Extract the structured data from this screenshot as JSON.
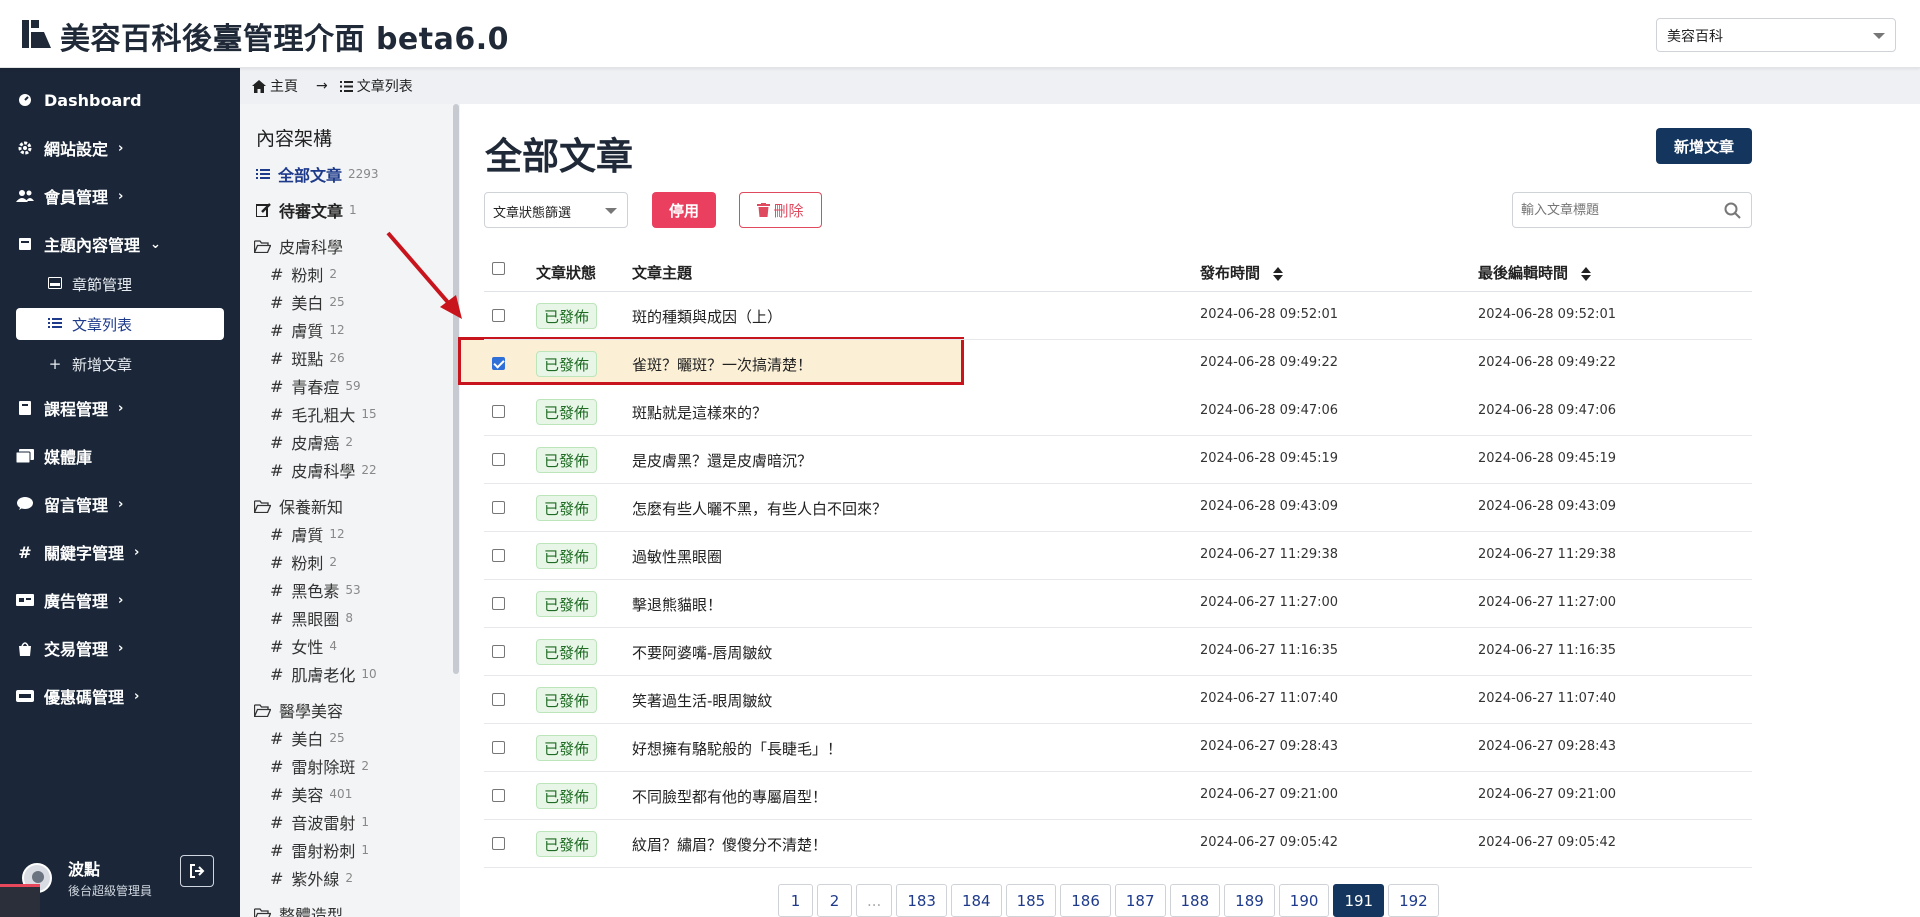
{
  "app_title": "美容百科後臺管理介面 beta6.0",
  "site_selector": {
    "value": "美容百科"
  },
  "sidebar": {
    "items": [
      {
        "label": "Dashboard"
      },
      {
        "label": "網站設定"
      },
      {
        "label": "會員管理"
      },
      {
        "label": "主題內容管理"
      },
      {
        "label": "課程管理"
      },
      {
        "label": "媒體庫"
      },
      {
        "label": "留言管理"
      },
      {
        "label": "關鍵字管理"
      },
      {
        "label": "廣告管理"
      },
      {
        "label": "交易管理"
      },
      {
        "label": "優惠碼管理"
      }
    ],
    "sub_items": [
      {
        "label": "章節管理"
      },
      {
        "label": "文章列表"
      },
      {
        "label": "新增文章"
      }
    ],
    "user": {
      "name": "波點",
      "role": "後台超級管理員"
    }
  },
  "breadcrumb": {
    "home": "主頁",
    "current": "文章列表"
  },
  "category_panel": {
    "heading": "內容架構",
    "all": {
      "label": "全部文章",
      "count": "2293"
    },
    "pending": {
      "label": "待審文章",
      "count": "1"
    },
    "groups": [
      {
        "name": "皮膚科學",
        "items": [
          {
            "label": "粉刺",
            "count": "2"
          },
          {
            "label": "美白",
            "count": "25"
          },
          {
            "label": "膚質",
            "count": "12"
          },
          {
            "label": "斑點",
            "count": "26"
          },
          {
            "label": "青春痘",
            "count": "59"
          },
          {
            "label": "毛孔粗大",
            "count": "15"
          },
          {
            "label": "皮膚癌",
            "count": "2"
          },
          {
            "label": "皮膚科學",
            "count": "22"
          }
        ]
      },
      {
        "name": "保養新知",
        "items": [
          {
            "label": "膚質",
            "count": "12"
          },
          {
            "label": "粉刺",
            "count": "2"
          },
          {
            "label": "黑色素",
            "count": "53"
          },
          {
            "label": "黑眼圈",
            "count": "8"
          },
          {
            "label": "女性",
            "count": "4"
          },
          {
            "label": "肌膚老化",
            "count": "10"
          }
        ]
      },
      {
        "name": "醫學美容",
        "items": [
          {
            "label": "美白",
            "count": "25"
          },
          {
            "label": "雷射除斑",
            "count": "2"
          },
          {
            "label": "美容",
            "count": "401"
          },
          {
            "label": "音波雷射",
            "count": "1"
          },
          {
            "label": "雷射粉刺",
            "count": "1"
          },
          {
            "label": "紫外線",
            "count": "2"
          }
        ]
      },
      {
        "name": "整體造型",
        "items": []
      }
    ]
  },
  "main": {
    "title": "全部文章",
    "new_button": "新增文章",
    "status_filter": "文章狀態篩選",
    "disable_button": "停用",
    "delete_button": "刪除",
    "search_placeholder": "輸入文章標題",
    "columns": {
      "status": "文章狀態",
      "topic": "文章主題",
      "published": "發布時間",
      "edited": "最後編輯時間"
    },
    "rows": [
      {
        "status": "已發佈",
        "topic": "斑的種類與成因（上）",
        "published": "2024-06-28 09:52:01",
        "edited": "2024-06-28 09:52:01",
        "checked": false
      },
      {
        "status": "已發佈",
        "topic": "雀斑？曬斑？一次搞清楚！",
        "published": "2024-06-28 09:49:22",
        "edited": "2024-06-28 09:49:22",
        "checked": true
      },
      {
        "status": "已發佈",
        "topic": "斑點就是這樣來的？",
        "published": "2024-06-28 09:47:06",
        "edited": "2024-06-28 09:47:06",
        "checked": false
      },
      {
        "status": "已發佈",
        "topic": "是皮膚黑？還是皮膚暗沉？",
        "published": "2024-06-28 09:45:19",
        "edited": "2024-06-28 09:45:19",
        "checked": false
      },
      {
        "status": "已發佈",
        "topic": "怎麼有些人曬不黑，有些人白不回來？",
        "published": "2024-06-28 09:43:09",
        "edited": "2024-06-28 09:43:09",
        "checked": false
      },
      {
        "status": "已發佈",
        "topic": "過敏性黑眼圈",
        "published": "2024-06-27 11:29:38",
        "edited": "2024-06-27 11:29:38",
        "checked": false
      },
      {
        "status": "已發佈",
        "topic": "擊退熊貓眼！",
        "published": "2024-06-27 11:27:00",
        "edited": "2024-06-27 11:27:00",
        "checked": false
      },
      {
        "status": "已發佈",
        "topic": "不要阿婆嘴-唇周皺紋",
        "published": "2024-06-27 11:16:35",
        "edited": "2024-06-27 11:16:35",
        "checked": false
      },
      {
        "status": "已發佈",
        "topic": "笑著過生活-眼周皺紋",
        "published": "2024-06-27 11:07:40",
        "edited": "2024-06-27 11:07:40",
        "checked": false
      },
      {
        "status": "已發佈",
        "topic": "好想擁有駱駝般的「長睫毛」！",
        "published": "2024-06-27 09:28:43",
        "edited": "2024-06-27 09:28:43",
        "checked": false
      },
      {
        "status": "已發佈",
        "topic": "不同臉型都有他的專屬眉型！",
        "published": "2024-06-27 09:21:00",
        "edited": "2024-06-27 09:21:00",
        "checked": false
      },
      {
        "status": "已發佈",
        "topic": "紋眉？繡眉？傻傻分不清楚！",
        "published": "2024-06-27 09:05:42",
        "edited": "2024-06-27 09:05:42",
        "checked": false
      }
    ]
  },
  "pagination": {
    "pages": [
      "1",
      "2",
      "...",
      "183",
      "184",
      "185",
      "186",
      "187",
      "188",
      "189",
      "190",
      "191",
      "192"
    ],
    "active": "191"
  },
  "colors": {
    "sidebar": "#1b2738",
    "primary": "#14365e",
    "danger": "#ea3f5f",
    "highlight": "#c8141d",
    "badge_bg": "#e8f6e7"
  },
  "icons": [
    "logo-icon",
    "home-icon",
    "list-icon",
    "edit-icon",
    "folder-icon",
    "hash-icon",
    "trash-icon",
    "search-icon",
    "sort-icon",
    "logout-icon",
    "gear-icon",
    "users-icon",
    "book-icon",
    "media-icon",
    "comment-icon",
    "ad-icon",
    "bag-icon",
    "ticket-icon",
    "dashboard-icon"
  ]
}
